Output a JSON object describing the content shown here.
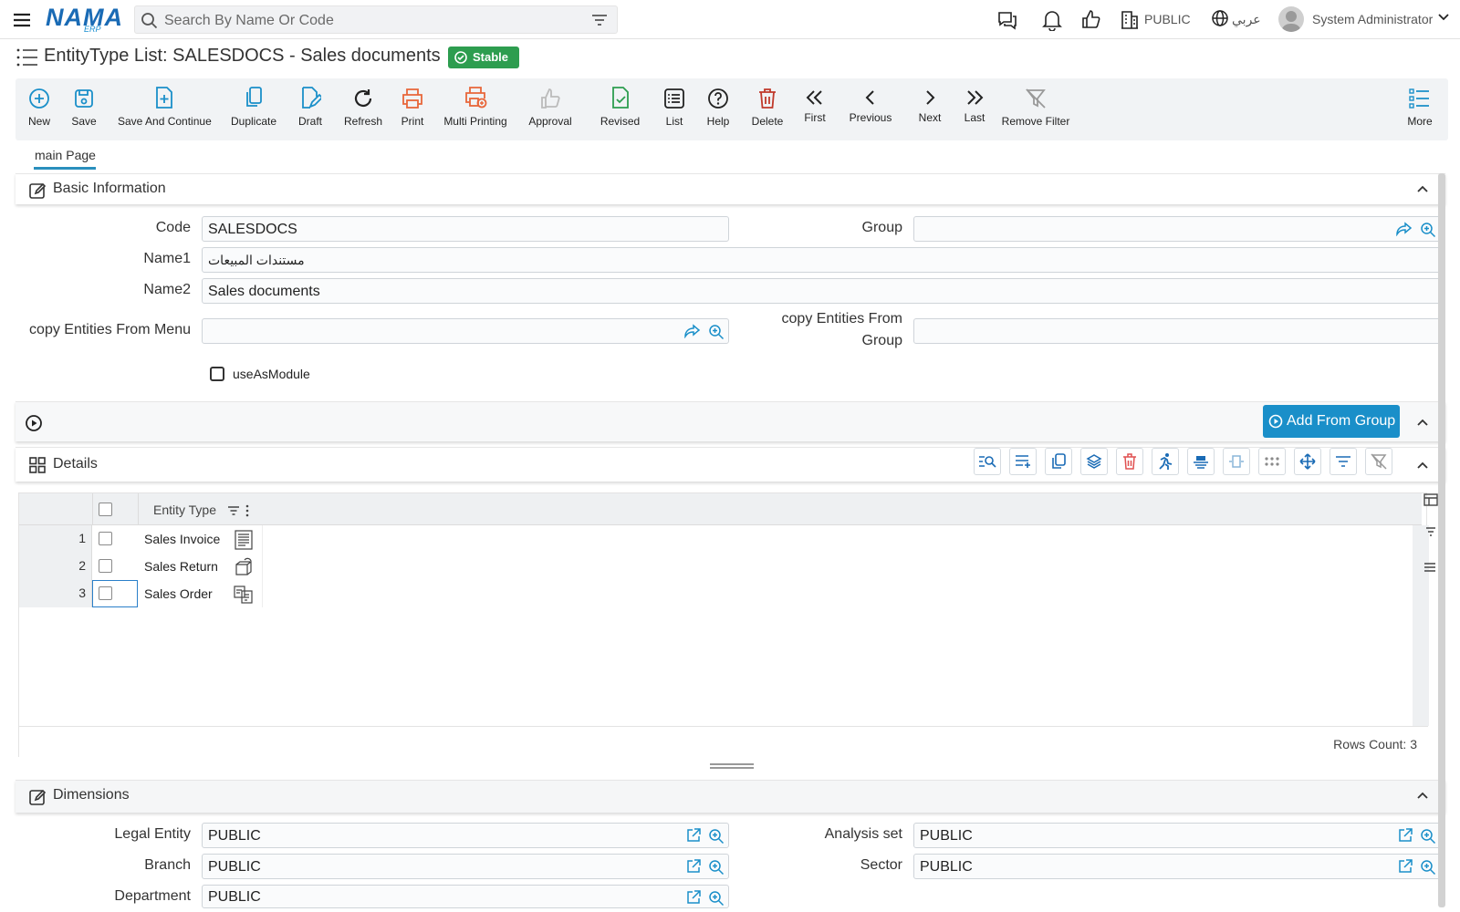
{
  "topbar": {
    "logo_main": "NAMA",
    "logo_sub": "ERP",
    "search_placeholder": "Search By Name Or Code",
    "company": "PUBLIC",
    "language": "عربي",
    "user": "System Administrator"
  },
  "page": {
    "title": "EntityType List: SALESDOCS - Sales documents",
    "status_badge": "Stable"
  },
  "toolbar": [
    {
      "label": "New",
      "icon": "plus-circle-icon",
      "color": "#1a8fc9"
    },
    {
      "label": "Save",
      "icon": "save-icon",
      "color": "#1a8fc9"
    },
    {
      "label": "Save And Continue",
      "icon": "save-continue-icon",
      "color": "#1a8fc9"
    },
    {
      "label": "Duplicate",
      "icon": "duplicate-icon",
      "color": "#1a8fc9"
    },
    {
      "label": "Draft",
      "icon": "draft-icon",
      "color": "#1a8fc9"
    },
    {
      "label": "Refresh",
      "icon": "refresh-icon",
      "color": "#222222"
    },
    {
      "label": "Print",
      "icon": "print-icon",
      "color": "#e8663a"
    },
    {
      "label": "Multi Printing",
      "icon": "multi-print-icon",
      "color": "#e8663a"
    },
    {
      "label": "Approval",
      "icon": "thumbs-up-icon",
      "color": "#bbbbbb"
    },
    {
      "label": "Revised",
      "icon": "revised-icon",
      "color": "#2d9d4f"
    },
    {
      "label": "List",
      "icon": "list-icon",
      "color": "#222222"
    },
    {
      "label": "Help",
      "icon": "help-icon",
      "color": "#222222"
    },
    {
      "label": "Delete",
      "icon": "trash-icon",
      "color": "#c0392b"
    },
    {
      "label": "First",
      "icon": "double-chevron-left-icon",
      "color": "#222222"
    },
    {
      "label": "Previous",
      "icon": "chevron-left-icon",
      "color": "#222222"
    },
    {
      "label": "Next",
      "icon": "chevron-right-icon",
      "color": "#222222"
    },
    {
      "label": "Last",
      "icon": "double-chevron-right-icon",
      "color": "#222222"
    },
    {
      "label": "Remove Filter",
      "icon": "filter-off-icon",
      "color": "#999999"
    },
    {
      "label": "More",
      "icon": "more-list-icon",
      "color": "#1a8fc9"
    }
  ],
  "tabs": [
    "main Page"
  ],
  "basic_info": {
    "header": "Basic Information",
    "code_label": "Code",
    "code_value": "SALESDOCS",
    "group_label": "Group",
    "group_value": "",
    "name1_label": "Name1",
    "name1_value": "مستندات المبيعات",
    "name2_label": "Name2",
    "name2_value": "Sales documents",
    "copy_menu_label": "copy Entities From Menu",
    "copy_menu_value": "",
    "copy_group_label_1": "copy Entities From",
    "copy_group_label_2": "Group",
    "copy_group_value": "",
    "use_as_module_label": "useAsModule",
    "use_as_module_checked": false
  },
  "actions": {
    "add_from_group": "Add From Group"
  },
  "details": {
    "header": "Details",
    "column": "Entity Type",
    "rows": [
      {
        "num": "1",
        "value": "Sales Invoice"
      },
      {
        "num": "2",
        "value": "Sales Return"
      },
      {
        "num": "3",
        "value": "Sales Order"
      }
    ],
    "rows_count": "Rows Count: 3"
  },
  "dimensions": {
    "header": "Dimensions",
    "legal_entity_label": "Legal Entity",
    "legal_entity_value": "PUBLIC",
    "analysis_set_label": "Analysis set",
    "analysis_set_value": "PUBLIC",
    "branch_label": "Branch",
    "branch_value": "PUBLIC",
    "sector_label": "Sector",
    "sector_value": "PUBLIC",
    "department_label": "Department",
    "department_value": "PUBLIC"
  }
}
